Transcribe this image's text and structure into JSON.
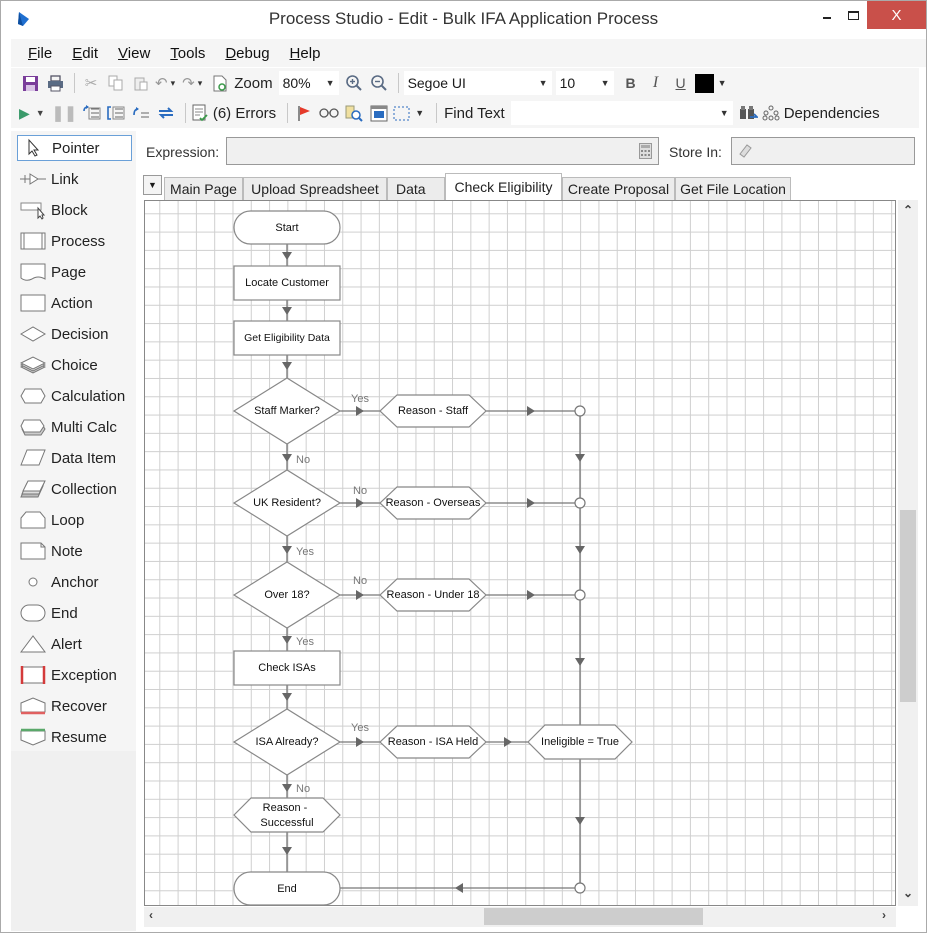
{
  "window": {
    "title": "Process Studio  - Edit - Bulk IFA Application Process",
    "app_icon": "blueprism-logo-icon",
    "controls": {
      "minimize": "‒",
      "maximize": "☐",
      "close": "X"
    }
  },
  "menu": [
    {
      "label": "File",
      "accel": "F",
      "rest": "ile"
    },
    {
      "label": "Edit",
      "accel": "E",
      "rest": "dit"
    },
    {
      "label": "View",
      "accel": "V",
      "rest": "iew"
    },
    {
      "label": "Tools",
      "accel": "T",
      "rest": "ools"
    },
    {
      "label": "Debug",
      "accel": "D",
      "rest": "ebug"
    },
    {
      "label": "Help",
      "accel": "H",
      "rest": "elp"
    }
  ],
  "toolbar1": {
    "zoom_label": "Zoom",
    "zoom_value": "80%",
    "font_family": "Segoe UI",
    "font_size": "10",
    "bold": "B",
    "italic": "I",
    "underline": "U",
    "color": "#000000"
  },
  "toolbar2": {
    "errors_label": "(6) Errors",
    "find_text_label": "Find Text",
    "find_text_value": "",
    "dependencies_label": "Dependencies"
  },
  "toolbox": {
    "items": [
      {
        "label": "Pointer",
        "icon": "pointer-icon",
        "selected": true
      },
      {
        "label": "Link",
        "icon": "link-icon"
      },
      {
        "label": "Block",
        "icon": "block-icon"
      },
      {
        "label": "Process",
        "icon": "process-icon"
      },
      {
        "label": "Page",
        "icon": "page-icon"
      },
      {
        "label": "Action",
        "icon": "action-icon"
      },
      {
        "label": "Decision",
        "icon": "decision-icon"
      },
      {
        "label": "Choice",
        "icon": "choice-icon"
      },
      {
        "label": "Calculation",
        "icon": "calculation-icon"
      },
      {
        "label": "Multi Calc",
        "icon": "multi-calc-icon"
      },
      {
        "label": "Data Item",
        "icon": "data-item-icon"
      },
      {
        "label": "Collection",
        "icon": "collection-icon"
      },
      {
        "label": "Loop",
        "icon": "loop-icon"
      },
      {
        "label": "Note",
        "icon": "note-icon"
      },
      {
        "label": "Anchor",
        "icon": "anchor-icon"
      },
      {
        "label": "End",
        "icon": "end-icon"
      },
      {
        "label": "Alert",
        "icon": "alert-icon"
      },
      {
        "label": "Exception",
        "icon": "exception-icon"
      },
      {
        "label": "Recover",
        "icon": "recover-icon"
      },
      {
        "label": "Resume",
        "icon": "resume-icon"
      }
    ]
  },
  "expression": {
    "label": "Expression:",
    "value": "",
    "store_in_label": "Store In:",
    "store_in_value": ""
  },
  "tabs": [
    {
      "label": "Main Page"
    },
    {
      "label": "Upload Spreadsheet"
    },
    {
      "label": "Data"
    },
    {
      "label": "Check Eligibility",
      "active": true
    },
    {
      "label": "Create Proposal"
    },
    {
      "label": "Get File Location"
    }
  ],
  "flow": {
    "nodes": {
      "start": {
        "type": "terminal",
        "label": "Start"
      },
      "locate": {
        "type": "action",
        "label": "Locate Customer"
      },
      "geteligibility": {
        "type": "action",
        "label": "Get Eligibility Data"
      },
      "staff": {
        "type": "decision",
        "label": "Staff Marker?"
      },
      "r_staff": {
        "type": "calculation",
        "label": "Reason - Staff"
      },
      "uk": {
        "type": "decision",
        "label": "UK Resident?"
      },
      "r_overseas": {
        "type": "calculation",
        "label": "Reason - Overseas"
      },
      "over18": {
        "type": "decision",
        "label": "Over 18?"
      },
      "r_under18": {
        "type": "calculation",
        "label": "Reason - Under 18"
      },
      "checkisas": {
        "type": "action",
        "label": "Check ISAs"
      },
      "isaalready": {
        "type": "decision",
        "label": "ISA Already?"
      },
      "r_isaheld": {
        "type": "calculation",
        "label": "Reason - ISA Held"
      },
      "ineligible": {
        "type": "calculation",
        "label": "Ineligible = True"
      },
      "r_success_1": {
        "type": "calculation",
        "label": "Reason -"
      },
      "r_success_2": {
        "type": "calculation",
        "label": "Successful"
      },
      "end": {
        "type": "terminal",
        "label": "End"
      }
    },
    "edge_labels": {
      "staff_yes": "Yes",
      "staff_no": "No",
      "uk_no": "No",
      "uk_yes": "Yes",
      "over18_no": "No",
      "over18_yes": "Yes",
      "isa_yes": "Yes",
      "isa_no": "No"
    }
  },
  "scroll": {
    "vertical_position": 0.72,
    "horizontal_position": 0.55
  }
}
